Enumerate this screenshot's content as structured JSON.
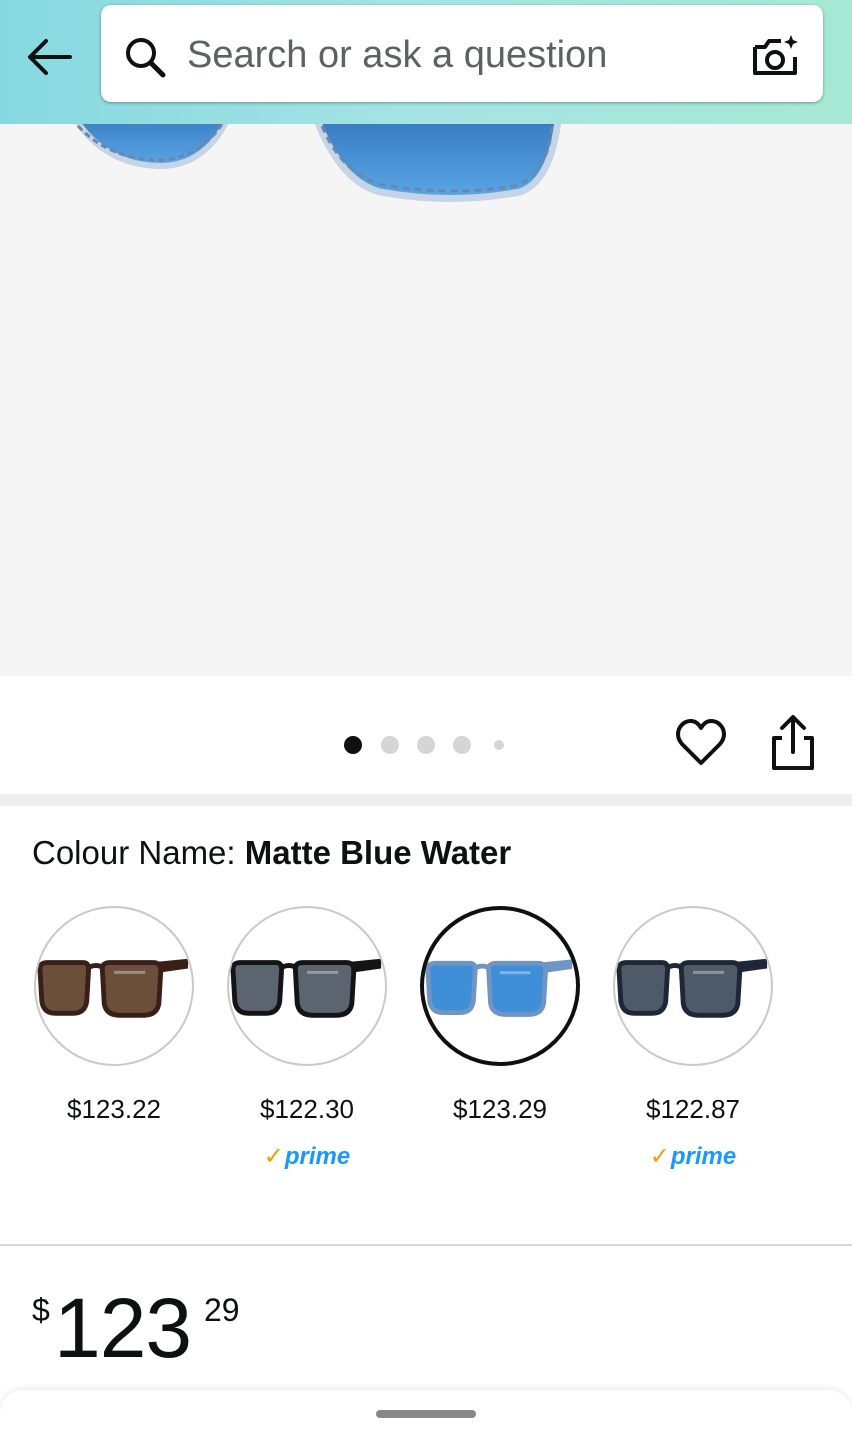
{
  "header": {
    "search_placeholder": "Search or ask a question",
    "back_icon": "arrow-left-icon",
    "search_icon": "search-icon",
    "camera_icon": "camera-sparkle-icon"
  },
  "gallery": {
    "dot_count": 5,
    "active_index": 0,
    "wishlist_icon": "heart-icon",
    "share_icon": "share-icon"
  },
  "colour": {
    "label": "Colour Name: ",
    "selected_name": "Matte Blue Water",
    "options": [
      {
        "price": "$123.22",
        "prime": "",
        "frame": "#3a1f18",
        "lens": "#6b4f3a",
        "selected": false
      },
      {
        "price": "$122.30",
        "prime": "prime",
        "frame": "#141414",
        "lens": "#5c6470",
        "selected": false
      },
      {
        "price": "$123.29",
        "prime": "",
        "frame": "#6f95c4",
        "lens": "#3f8ed8",
        "selected": true
      },
      {
        "price": "$122.87",
        "prime": "prime",
        "frame": "#1d2738",
        "lens": "#4f5a68",
        "selected": false
      }
    ]
  },
  "price": {
    "symbol": "$",
    "whole": "123",
    "fraction": "29"
  },
  "colors": {
    "header_gradient_start": "#86d8e0",
    "header_gradient_end": "#a7e8d4",
    "prime_blue": "#1a98ff",
    "prime_check": "#ff9900"
  }
}
